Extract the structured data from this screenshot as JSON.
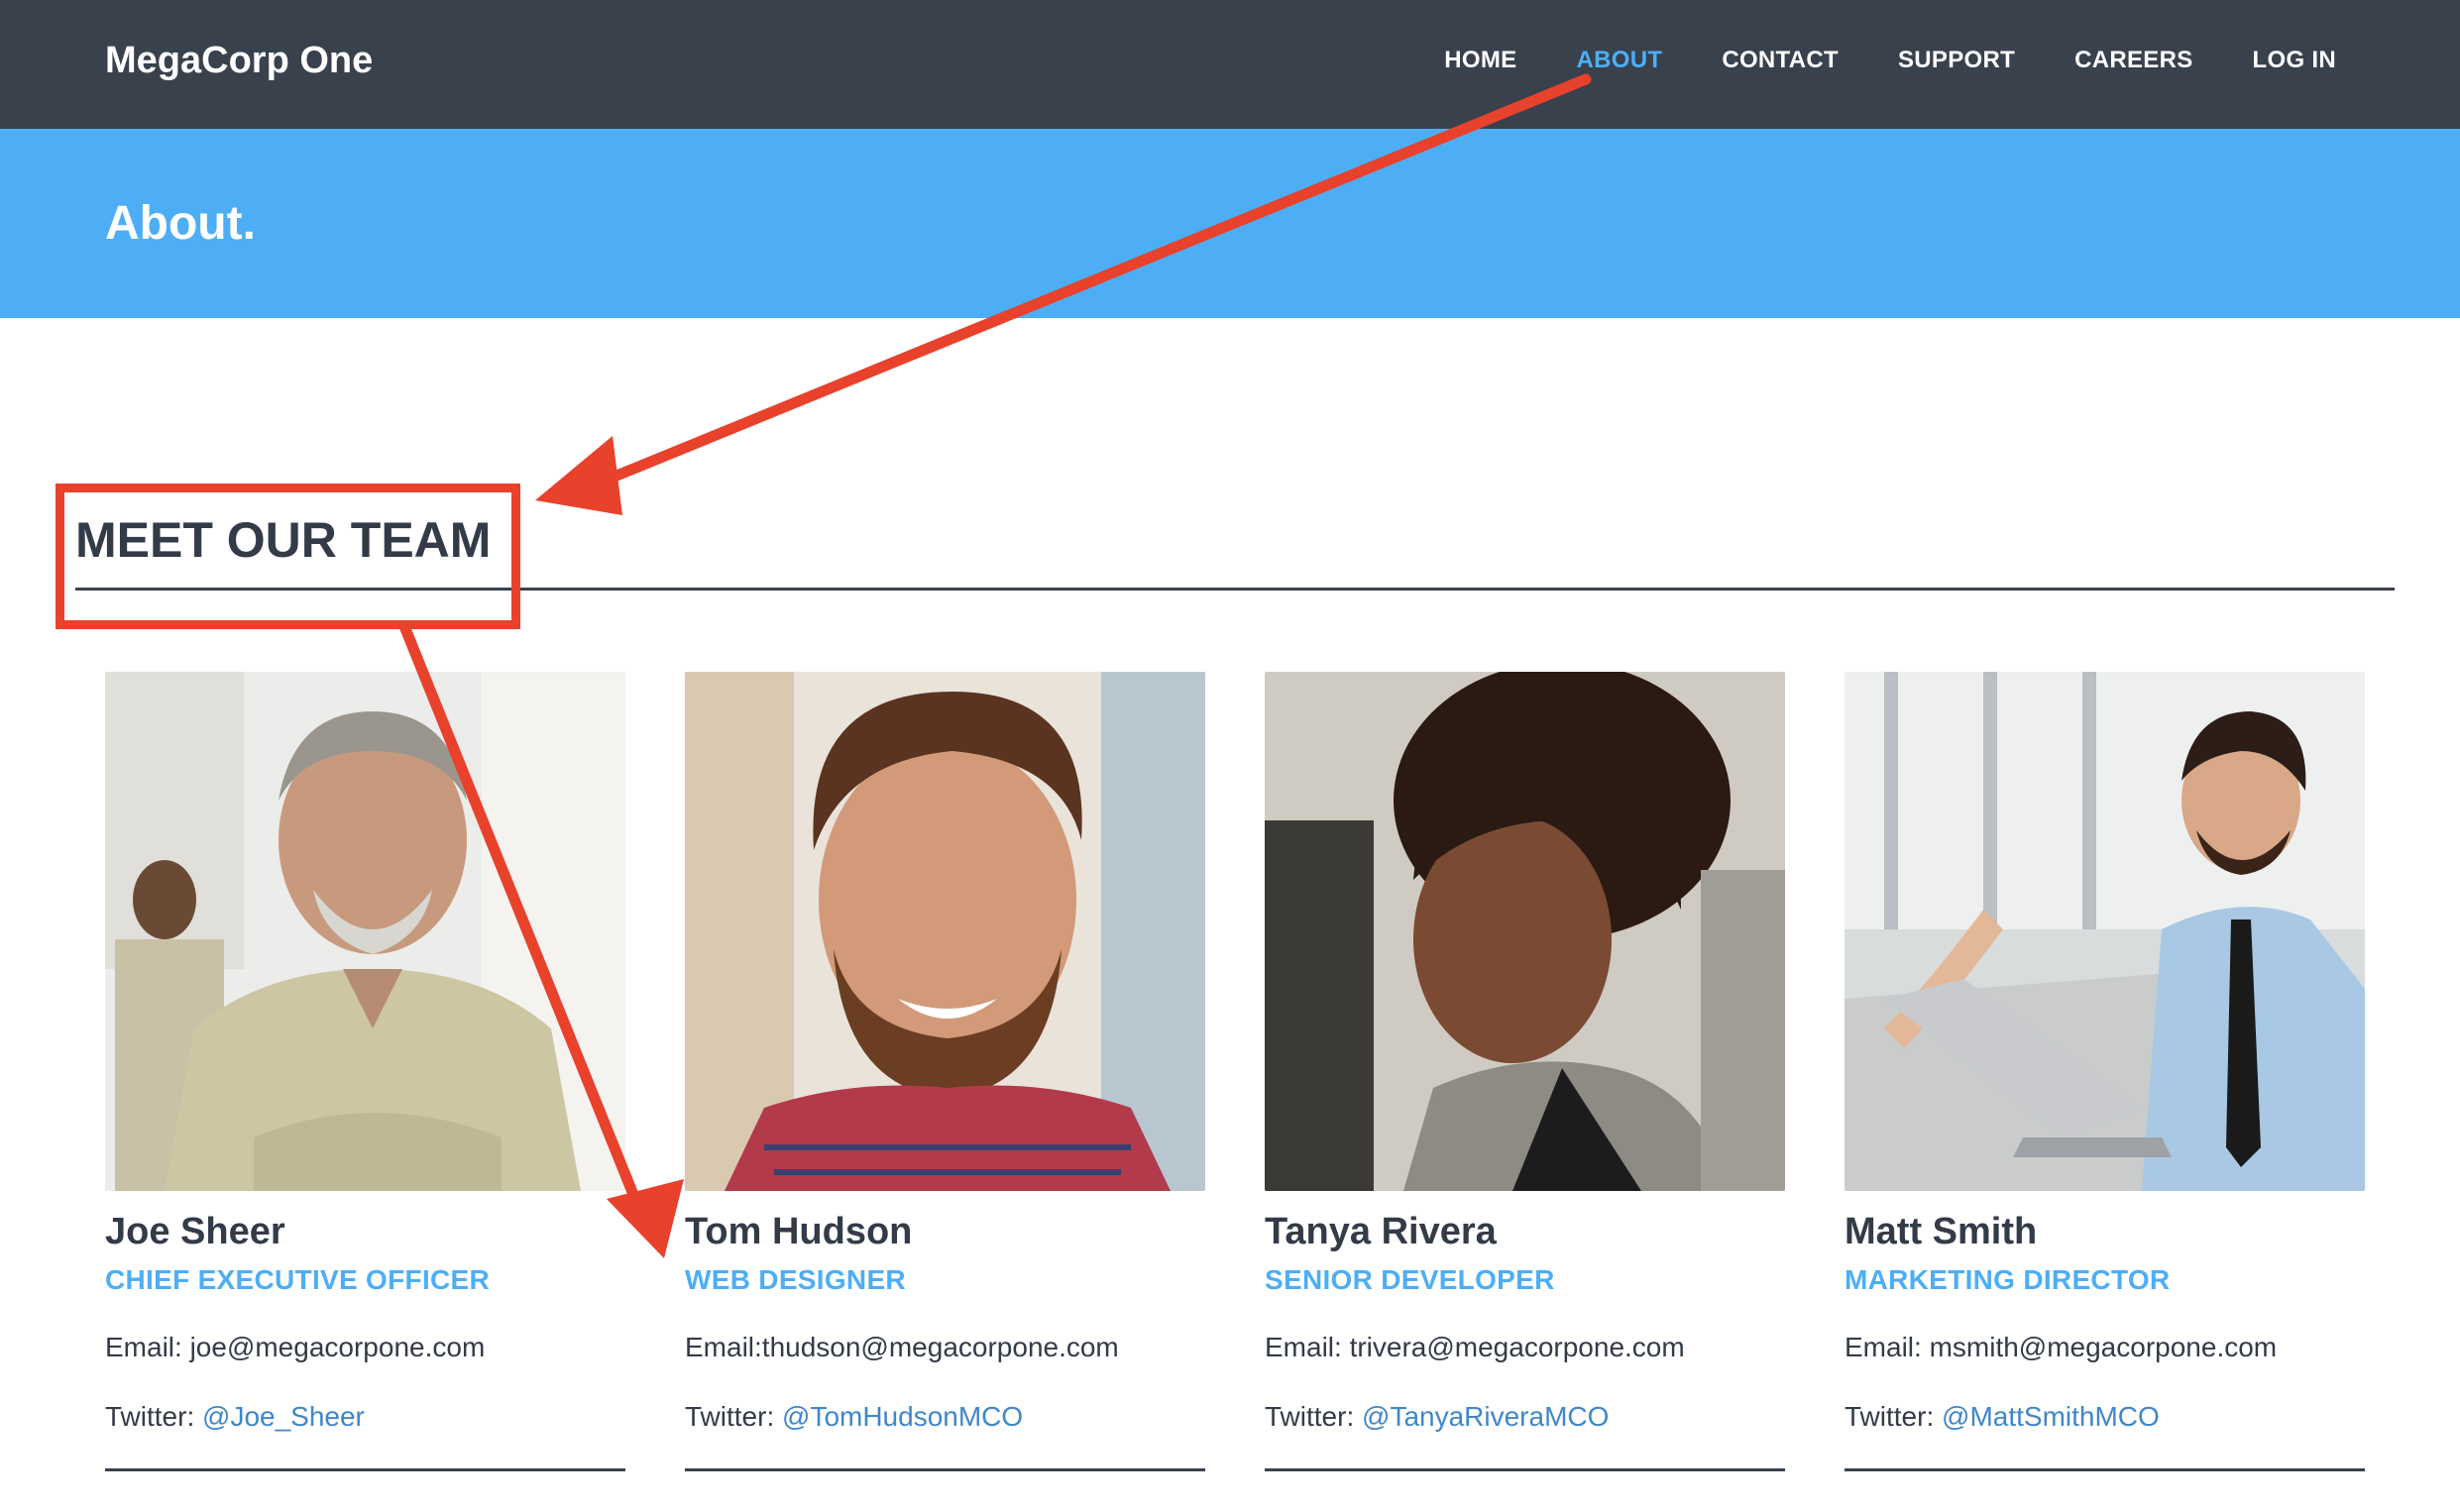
{
  "navbar": {
    "brand": "MegaCorp One",
    "items": [
      {
        "label": "HOME",
        "active": false
      },
      {
        "label": "ABOUT",
        "active": true
      },
      {
        "label": "CONTACT",
        "active": false
      },
      {
        "label": "SUPPORT",
        "active": false
      },
      {
        "label": "CAREERS",
        "active": false
      },
      {
        "label": "LOG IN",
        "active": false
      }
    ]
  },
  "banner": {
    "title": "About."
  },
  "team": {
    "heading": "MEET OUR TEAM",
    "members": [
      {
        "name": "Joe Sheer",
        "role": "CHIEF EXECUTIVE OFFICER",
        "email": "Email: joe@megacorpone.com",
        "twitter_label": "Twitter: ",
        "twitter_handle": "@Joe_Sheer",
        "photo": "photo-joe-sheer"
      },
      {
        "name": "Tom Hudson",
        "role": "WEB DESIGNER",
        "email": "Email:thudson@megacorpone.com",
        "twitter_label": "Twitter: ",
        "twitter_handle": "@TomHudsonMCO",
        "photo": "photo-tom-hudson"
      },
      {
        "name": "Tanya Rivera",
        "role": "SENIOR DEVELOPER",
        "email": "Email: trivera@megacorpone.com",
        "twitter_label": "Twitter: ",
        "twitter_handle": "@TanyaRiveraMCO",
        "photo": "photo-tanya-rivera"
      },
      {
        "name": "Matt Smith",
        "role": "MARKETING DIRECTOR",
        "email": "Email: msmith@megacorpone.com",
        "twitter_label": "Twitter: ",
        "twitter_handle": "@MattSmithMCO",
        "photo": "photo-matt-smith"
      }
    ]
  },
  "colors": {
    "navbar_bg": "#39414d",
    "accent_blue": "#4daef5",
    "link_blue": "#3f87c9",
    "text_dark": "#333b48",
    "annotation_red": "#e8412c"
  }
}
